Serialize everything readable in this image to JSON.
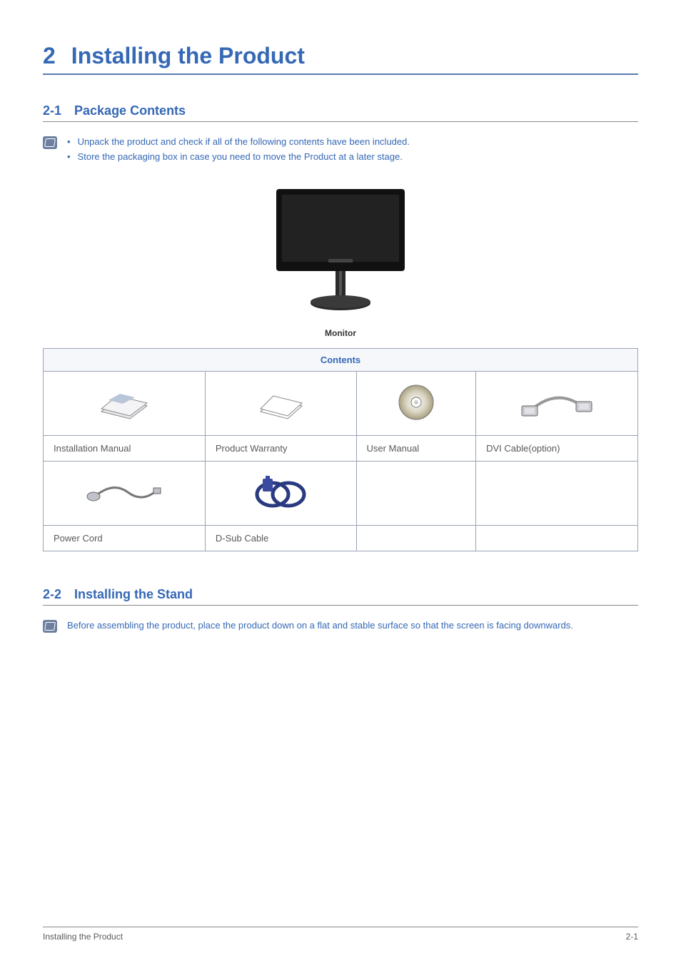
{
  "chapter": {
    "number": "2",
    "title": "Installing the Product"
  },
  "section1": {
    "number": "2-1",
    "title": "Package Contents",
    "bullets": [
      "Unpack the product and check if all of the following contents have been included.",
      "Store the packaging box in case you need to move the Product at a later stage."
    ]
  },
  "monitor_caption": "Monitor",
  "table": {
    "header": "Contents",
    "row1": [
      "Installation Manual",
      "Product Warranty",
      "User Manual",
      "DVI Cable(option)"
    ],
    "row2": [
      "Power Cord",
      "D-Sub Cable",
      "",
      ""
    ]
  },
  "section2": {
    "number": "2-2",
    "title": "Installing the Stand",
    "note": "Before assembling the product, place the product down on a flat and stable surface so that the screen is facing downwards."
  },
  "footer": {
    "left": "Installing the Product",
    "right": "2-1"
  }
}
